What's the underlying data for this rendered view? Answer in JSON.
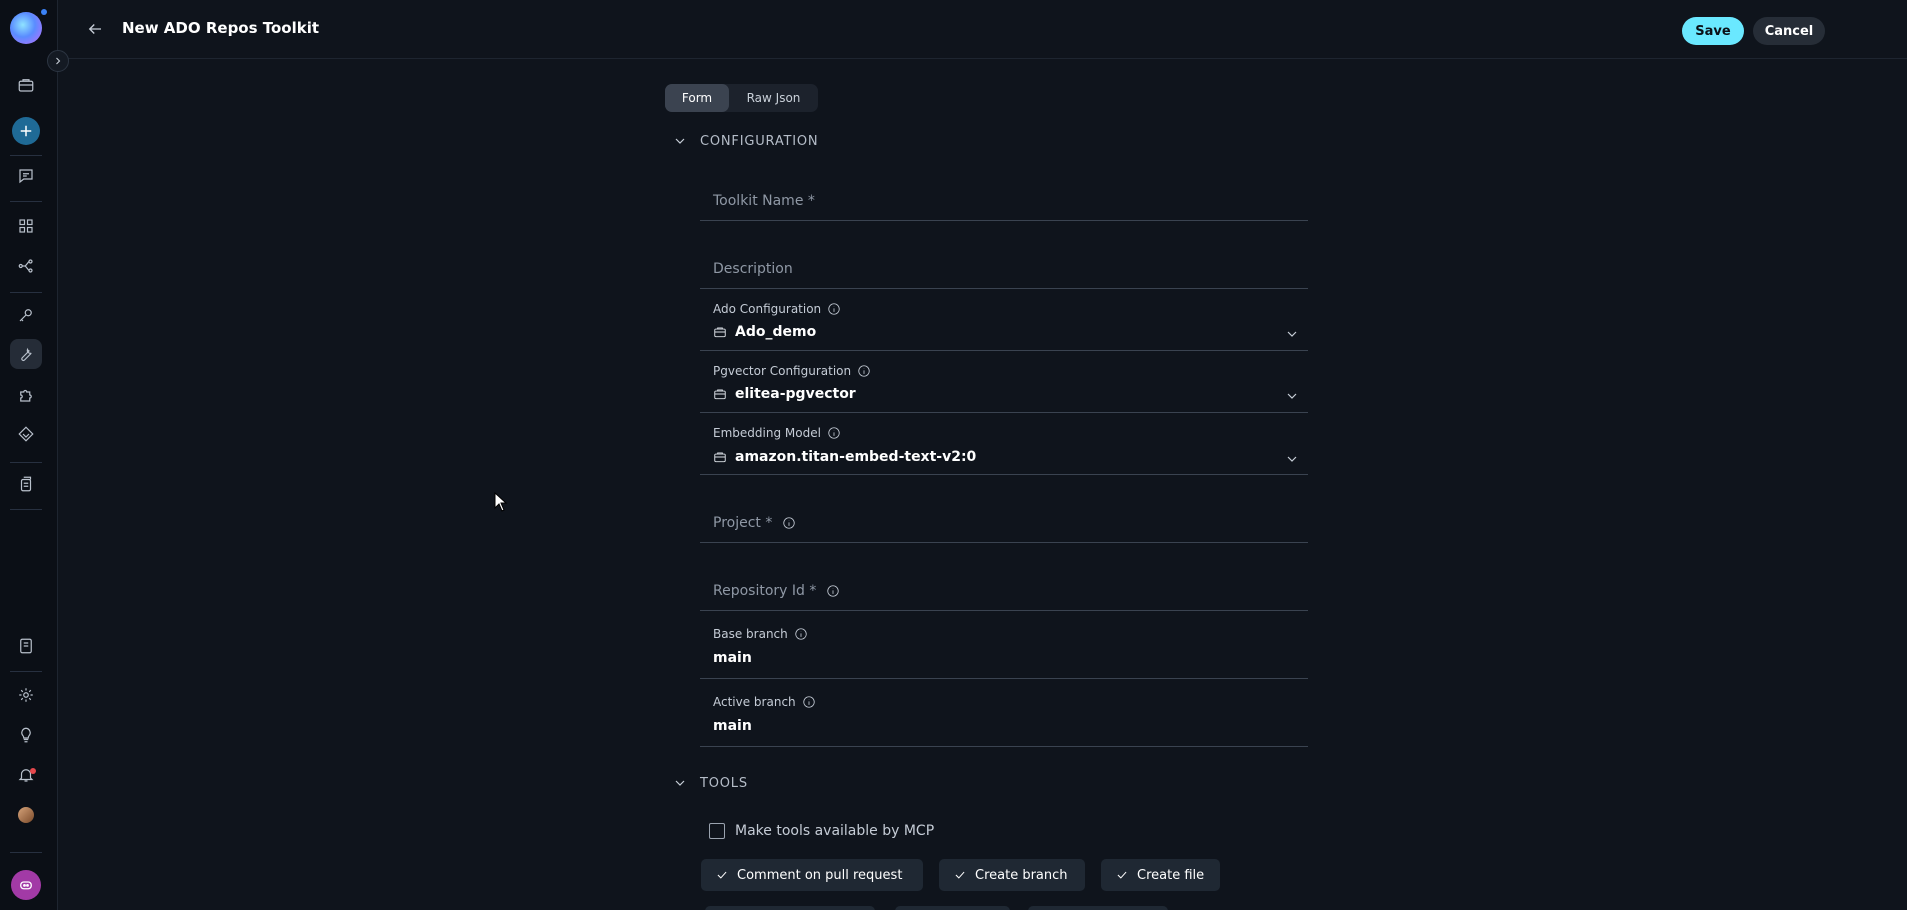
{
  "header": {
    "title": "New ADO Repos Toolkit",
    "save_label": "Save",
    "cancel_label": "Cancel"
  },
  "tabs": [
    {
      "label": "Form",
      "active": true
    },
    {
      "label": "Raw Json",
      "active": false
    }
  ],
  "configuration": {
    "section_title": "CONFIGURATION",
    "toolkit_name": {
      "placeholder": "Toolkit Name *",
      "value": ""
    },
    "description": {
      "placeholder": "Description",
      "value": ""
    },
    "ado_configuration": {
      "label": "Ado Configuration",
      "value": "Ado_demo"
    },
    "pgvector_configuration": {
      "label": "Pgvector Configuration",
      "value": "elitea-pgvector"
    },
    "embedding_model": {
      "label": "Embedding Model",
      "value": "amazon.titan-embed-text-v2:0"
    },
    "project": {
      "placeholder": "Project *",
      "value": ""
    },
    "repository_id": {
      "placeholder": "Repository Id *",
      "value": ""
    },
    "base_branch": {
      "label": "Base branch",
      "value": "main"
    },
    "active_branch": {
      "label": "Active branch",
      "value": "main"
    }
  },
  "tools": {
    "section_title": "TOOLS",
    "mcp_label": "Make tools available by MCP",
    "mcp_checked": false,
    "items": [
      {
        "label": "Comment on pull request",
        "checked": true
      },
      {
        "label": "Create branch",
        "checked": true
      },
      {
        "label": "Create file",
        "checked": true
      }
    ]
  },
  "colors": {
    "background": "#0f141c",
    "accent": "#6ae8ff",
    "chip": "#1f2833"
  }
}
